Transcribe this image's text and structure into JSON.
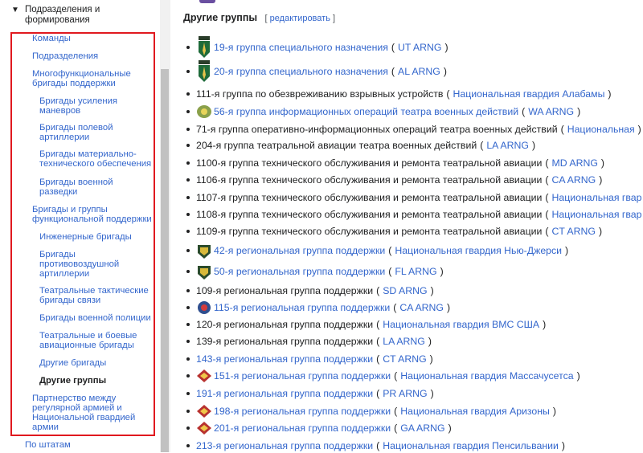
{
  "sidebar": {
    "section_title": "Подразделения и формирования",
    "items": [
      {
        "label": "Команды",
        "level": 1
      },
      {
        "label": "Подразделения",
        "level": 1
      },
      {
        "label": "Многофункциональные бригады поддержки",
        "level": 1,
        "lines": [
          "Многофункциональные",
          "бригады поддержки"
        ]
      },
      {
        "label": "Бригады усиления маневров",
        "level": 2,
        "lines": [
          "Бригады усиления",
          "маневров"
        ]
      },
      {
        "label": "Бригады полевой артиллерии",
        "level": 2,
        "lines": [
          "Бригады полевой",
          "артиллерии"
        ]
      },
      {
        "label": "Бригады материально-технического обеспечения",
        "level": 2,
        "lines": [
          "Бригады материально-",
          "технического обеспечения"
        ]
      },
      {
        "label": "Бригады военной разведки",
        "level": 2,
        "lines": [
          "Бригады военной",
          "разведки"
        ]
      },
      {
        "label": "Бригады и группы функциональной поддержки",
        "level": 1,
        "lines": [
          "Бригады и группы",
          "функциональной поддержки"
        ]
      },
      {
        "label": "Инженерные бригады",
        "level": 2
      },
      {
        "label": "Бригады противовоздушной артиллерии",
        "level": 2,
        "lines": [
          "Бригады",
          "противовоздушной",
          "артиллерии"
        ]
      },
      {
        "label": "Театральные тактические бригады связи",
        "level": 2,
        "lines": [
          "Театральные тактические",
          "бригады связи"
        ]
      },
      {
        "label": "Бригады военной полиции",
        "level": 2
      },
      {
        "label": "Театральные и боевые авиационные бригады",
        "level": 2,
        "lines": [
          "Театральные и боевые",
          "авиационные бригады"
        ]
      },
      {
        "label": "Другие бригады",
        "level": 2
      },
      {
        "label": "Другие группы",
        "level": 2,
        "current": true
      },
      {
        "label": "Партнерство между регулярной армией и Национальной гвардией армии",
        "level": 1,
        "lines": [
          "Партнерство между",
          "регулярной армией и",
          "Национальной гвардией",
          "армии"
        ]
      }
    ],
    "after_box": "По штатам"
  },
  "main": {
    "heading": "Другие группы",
    "edit_open": "[",
    "edit_label": "редактировать",
    "edit_close": "]",
    "rows": [
      {
        "icon": "sf-patch-icon",
        "name": "19-я группа специального назначения",
        "name_link": true,
        "paren": "UT ARNG"
      },
      {
        "icon": "sf-patch-icon",
        "name": "20-я группа специального назначения",
        "name_link": true,
        "paren": "AL ARNG"
      },
      {
        "icon": "",
        "name": "111-я группа по обезвреживанию взрывных устройств",
        "name_link": false,
        "paren": "Национальная гвардия Алабамы"
      },
      {
        "icon": "info-ops-patch-icon",
        "name": "56-я группа информационных операций театра военных действий",
        "name_link": true,
        "paren": "WA ARNG"
      },
      {
        "icon": "",
        "name": "71-я группа оперативно-информационных операций театра военных действий",
        "name_link": false,
        "paren": "Национальная"
      },
      {
        "icon": "",
        "name": "204-я группа театральной авиации театра военных действий",
        "name_link": false,
        "paren": "LA ARNG"
      },
      {
        "icon": "",
        "name": "1100-я группа технического обслуживания и ремонта театральной авиации",
        "name_link": false,
        "paren": "MD ARNG"
      },
      {
        "icon": "",
        "name": "1106-я группа технического обслуживания и ремонта театральной авиации",
        "name_link": false,
        "paren": "CA ARNG"
      },
      {
        "icon": "",
        "name": "1107-я группа технического обслуживания и ремонта театральной авиации",
        "name_link": false,
        "paren": "Национальная гвар"
      },
      {
        "icon": "",
        "name": "1108-я группа технического обслуживания и ремонта театральной авиации",
        "name_link": false,
        "paren": "Национальная гвар"
      },
      {
        "icon": "",
        "name": "1109-я группа технического обслуживания и ремонта театральной авиации",
        "name_link": false,
        "paren": "CT ARNG"
      },
      {
        "icon": "shield-patch-icon",
        "name": "42-я региональная группа поддержки",
        "name_link": true,
        "paren": "Национальная гвардия Нью-Джерси"
      },
      {
        "icon": "shield-patch-icon",
        "name": "50-я региональная группа поддержки",
        "name_link": true,
        "paren": "FL ARNG"
      },
      {
        "icon": "",
        "name": "109-я региональная группа поддержки",
        "name_link": false,
        "paren": "SD ARNG"
      },
      {
        "icon": "round-patch-icon",
        "name": "115-я региональная группа поддержки",
        "name_link": true,
        "paren": "CA ARNG"
      },
      {
        "icon": "",
        "name": "120-я региональная группа поддержки",
        "name_link": false,
        "paren": "Национальная гвардия ВМС США"
      },
      {
        "icon": "",
        "name": "139-я региональная группа поддержки",
        "name_link": false,
        "paren": "LA ARNG"
      },
      {
        "icon": "",
        "name": "143-я региональная группа поддержки",
        "name_link": true,
        "paren": "CT ARNG"
      },
      {
        "icon": "diamond-patch-icon",
        "name": "151-я региональная группа поддержки",
        "name_link": true,
        "paren": "Национальная гвардия Массачусетса"
      },
      {
        "icon": "",
        "name": "191-я региональная группа поддержки",
        "name_link": true,
        "paren": "PR ARNG"
      },
      {
        "icon": "diamond-patch-icon",
        "name": "198-я региональная группа поддержки",
        "name_link": true,
        "paren": "Национальная гвардия Аризоны"
      },
      {
        "icon": "diamond-patch-icon",
        "name": "201-я региональная группа поддержки",
        "name_link": true,
        "paren": "GA ARNG"
      },
      {
        "icon": "",
        "name": "213-я региональная группа поддержки",
        "name_link": true,
        "paren": "Национальная гвардия Пенсильвании"
      }
    ]
  },
  "colors": {
    "link": "#3366cc",
    "text": "#202122",
    "highlight_box": "#e0191f",
    "scroll_thumb": "#c1c1c1"
  }
}
